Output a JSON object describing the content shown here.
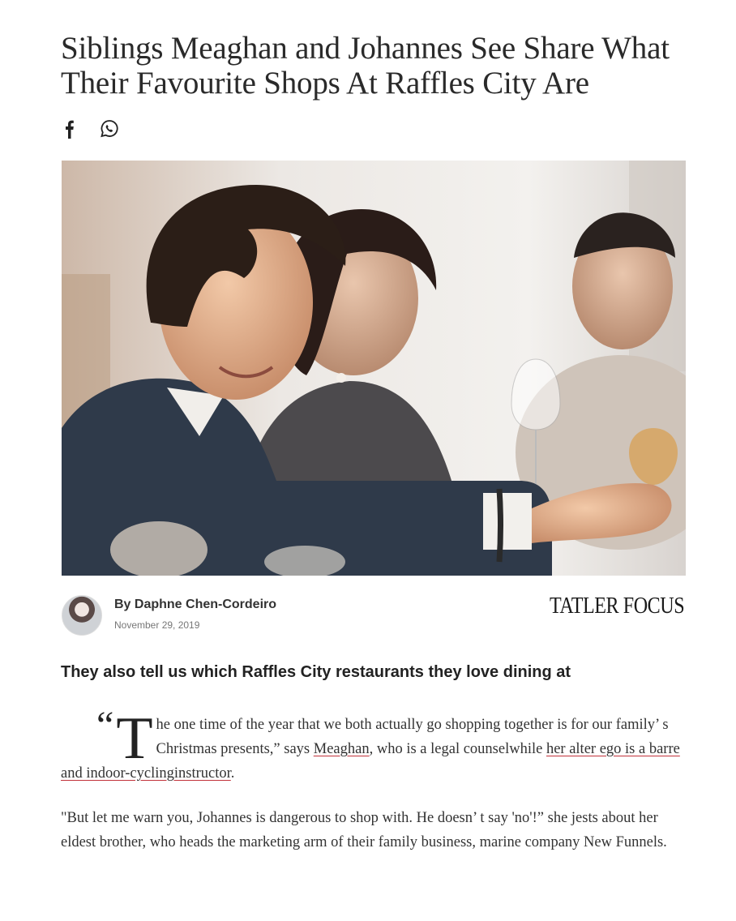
{
  "article": {
    "title": "Siblings Meaghan and Johannes See Share What Their Favourite Shops At Raffles City Are",
    "share": {
      "icons": [
        "facebook-icon",
        "whatsapp-icon"
      ]
    },
    "hero_image": {
      "kind": "photo"
    },
    "author": {
      "name": "By Daphne Chen-Cordeiro",
      "date": "November 29, 2019"
    },
    "brand": "TATLER FOCUS",
    "subheading": "They also tell us which Raffles City restaurants they love dining at",
    "paragraph1": {
      "quote_mark": "“",
      "dropcap": "T",
      "text_a": "he one time of the year that we both actually go shopping together is for our family’ s Christmas presents,”  says ",
      "link_meaghan": "Meaghan",
      "text_b": ", who is a legal counselwhile ",
      "link_alter_ego": "her alter ego is a barre and indoor-cyclinginstructor",
      "text_c": "."
    },
    "paragraph2": "\"But let me warn you, Johannes is dangerous to shop with. He doesn’ t say 'no'!”  she jests about her eldest brother, who heads the marketing arm of their family business, marine company New Funnels."
  },
  "colors": {
    "link_underline": "#c2323a",
    "text": "#333333"
  }
}
